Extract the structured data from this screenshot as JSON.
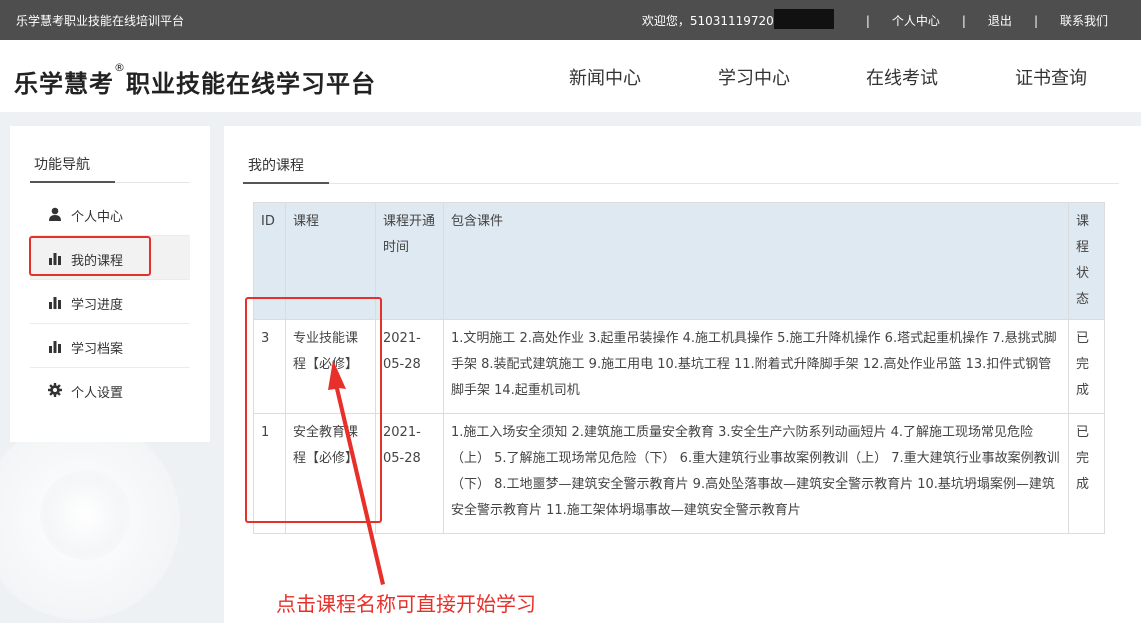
{
  "topbar": {
    "site_name": "乐学慧考职业技能在线培训平台",
    "welcome": "欢迎您，51031119720",
    "sep": "|",
    "links": [
      "个人中心",
      "退出",
      "联系我们"
    ]
  },
  "header": {
    "logo": "乐学慧考",
    "logo_mark": "®",
    "logo_rest": "职业技能在线学习平台",
    "nav": [
      "新闻中心",
      "学习中心",
      "在线考试",
      "证书查询"
    ]
  },
  "sidebar": {
    "title": "功能导航",
    "items": [
      {
        "label": "个人中心",
        "icon": "user-icon"
      },
      {
        "label": "我的课程",
        "icon": "bar-chart-icon",
        "active": true
      },
      {
        "label": "学习进度",
        "icon": "bar-chart-icon"
      },
      {
        "label": "学习档案",
        "icon": "bar-chart-icon"
      },
      {
        "label": "个人设置",
        "icon": "gear-icon"
      }
    ]
  },
  "main": {
    "title": "我的课程",
    "table": {
      "headers": [
        "ID",
        "课程",
        "课程开通时间",
        "包含课件",
        "课程状态"
      ],
      "rows": [
        {
          "id": "3",
          "course": "专业技能课程【必修】",
          "date": "2021-05-28",
          "coursewares": "1.文明施工 2.高处作业 3.起重吊装操作 4.施工机具操作 5.施工升降机操作 6.塔式起重机操作 7.悬挑式脚手架 8.装配式建筑施工 9.施工用电 10.基坑工程 11.附着式升降脚手架 12.高处作业吊篮 13.扣件式钢管脚手架 14.起重机司机",
          "status": "已完成"
        },
        {
          "id": "1",
          "course": "安全教育课程【必修】",
          "date": "2021-05-28",
          "coursewares": "1.施工入场安全须知 2.建筑施工质量安全教育 3.安全生产六防系列动画短片 4.了解施工现场常见危险（上） 5.了解施工现场常见危险（下） 6.重大建筑行业事故案例教训（上） 7.重大建筑行业事故案例教训（下） 8.工地噩梦—建筑安全警示教育片 9.高处坠落事故—建筑安全警示教育片 10.基坑坍塌案例—建筑安全警示教育片 11.施工架体坍塌事故—建筑安全警示教育片",
          "status": "已完成"
        }
      ]
    }
  },
  "annotation": {
    "text": "点击课程名称可直接开始学习",
    "color": "#e8302a"
  }
}
